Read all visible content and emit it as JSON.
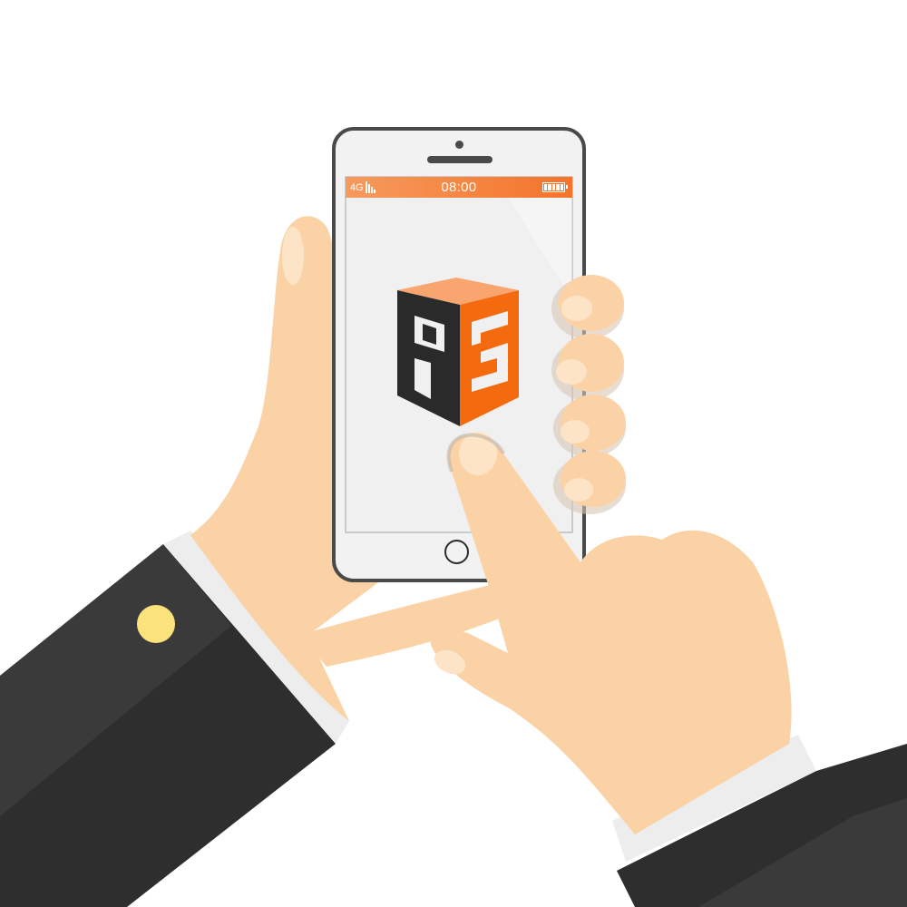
{
  "phone": {
    "status_bar": {
      "network": "4G",
      "signal_icon": "signal-bars-icon",
      "time": "08:00",
      "battery_icon": "battery-full-icon",
      "battery_level": 1.0,
      "background_color": "#f4742a"
    },
    "screen": {
      "app_logo": "ps-cube-logo",
      "logo_colors": {
        "top": "#f8a56f",
        "right": "#f46a0f",
        "left": "#2a2a2a"
      },
      "background_color": "#f0f0f0"
    },
    "home_button_icon": "home-button-icon"
  },
  "colors": {
    "skin": "#fad2a5",
    "skin_shadow": "#f0c08c",
    "sleeve": "#2e2e2e",
    "cuff": "#ededed",
    "cufflink": "#fbe27a"
  }
}
